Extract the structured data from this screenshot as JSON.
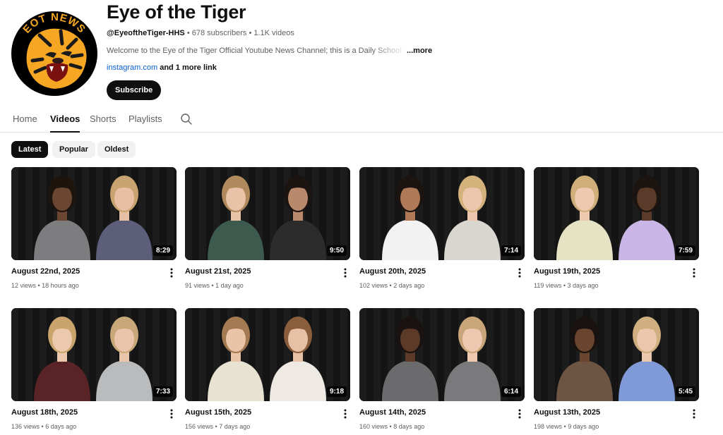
{
  "channel": {
    "name": "Eye of the Tiger",
    "handle": "@EyeoftheTiger-HHS",
    "subscribers": "678 subscribers",
    "video_count": "1.1K videos",
    "separator": " • ",
    "description": "Welcome to the Eye of the Tiger Official Youtube News Channel; this is a Daily School News",
    "description_more": "...more",
    "link": "instagram.com",
    "more_links": " and 1 more link",
    "subscribe_label": "Subscribe",
    "avatar_text": "EOT NEWS"
  },
  "tabs": [
    {
      "label": "Home",
      "active": false
    },
    {
      "label": "Videos",
      "active": true
    },
    {
      "label": "Shorts",
      "active": false
    },
    {
      "label": "Playlists",
      "active": false
    }
  ],
  "filters": [
    {
      "label": "Latest",
      "active": true
    },
    {
      "label": "Popular",
      "active": false
    },
    {
      "label": "Oldest",
      "active": false
    }
  ],
  "videos": [
    {
      "title": "August 22nd, 2025",
      "views": "12 views",
      "age": "18 hours ago",
      "duration": "8:29",
      "shirts": [
        "#7d7d80",
        "#5d5f7a"
      ],
      "hair": [
        "#1e140e",
        "#c8a470"
      ],
      "skin": [
        "#6b4631",
        "#e6bfa5"
      ]
    },
    {
      "title": "August 21st, 2025",
      "views": "91 views",
      "age": "1 day ago",
      "duration": "9:50",
      "shirts": [
        "#3d5a4e",
        "#2c2c2c"
      ],
      "hair": [
        "#b08a5c",
        "#1b1411"
      ],
      "skin": [
        "#e8c3a8",
        "#b8896a"
      ]
    },
    {
      "title": "August 20th, 2025",
      "views": "102 views",
      "age": "2 days ago",
      "duration": "7:14",
      "shirts": [
        "#f2f2f2",
        "#d9d6cf"
      ],
      "hair": [
        "#1b1411",
        "#d4b27c"
      ],
      "skin": [
        "#b07a58",
        "#ecc7ae"
      ]
    },
    {
      "title": "August 19th, 2025",
      "views": "119 views",
      "age": "3 days ago",
      "duration": "7:59",
      "shirts": [
        "#e6e2c4",
        "#c9b5e6"
      ],
      "hair": [
        "#cfae7a",
        "#1b1411"
      ],
      "skin": [
        "#ecc9af",
        "#5a3a28"
      ]
    },
    {
      "title": "August 18th, 2025",
      "views": "136 views",
      "age": "6 days ago",
      "duration": "7:33",
      "shirts": [
        "#5a2326",
        "#b9bbbd"
      ],
      "hair": [
        "#c9a46d",
        "#c8a878"
      ],
      "skin": [
        "#ecc8ae",
        "#e8c5ab"
      ]
    },
    {
      "title": "August 15th, 2025",
      "views": "156 views",
      "age": "7 days ago",
      "duration": "9:18",
      "shirts": [
        "#e8e2d2",
        "#eeeae3"
      ],
      "hair": [
        "#a47a52",
        "#8a5e3c"
      ],
      "skin": [
        "#e9c4a9",
        "#e7c1a6"
      ]
    },
    {
      "title": "August 14th, 2025",
      "views": "160 views",
      "age": "8 days ago",
      "duration": "6:14",
      "shirts": [
        "#6b6b6e",
        "#7a7a7c"
      ],
      "hair": [
        "#1a1210",
        "#c9a57a"
      ],
      "skin": [
        "#5b3a28",
        "#ecc9b0"
      ]
    },
    {
      "title": "August 13th, 2025",
      "views": "198 views",
      "age": "9 days ago",
      "duration": "5:45",
      "shirts": [
        "#6e5443",
        "#7f9ad6"
      ],
      "hair": [
        "#1a1210",
        "#cfae80"
      ],
      "skin": [
        "#6a452f",
        "#ebc7ad"
      ]
    }
  ],
  "colors": {
    "accent": "#0f0f0f",
    "link": "#065fd4",
    "muted": "#606060",
    "chip_bg": "#f2f2f2",
    "tiger_orange": "#f5a623"
  },
  "icons": {
    "search": "search-icon",
    "more": "more-vert-icon"
  }
}
